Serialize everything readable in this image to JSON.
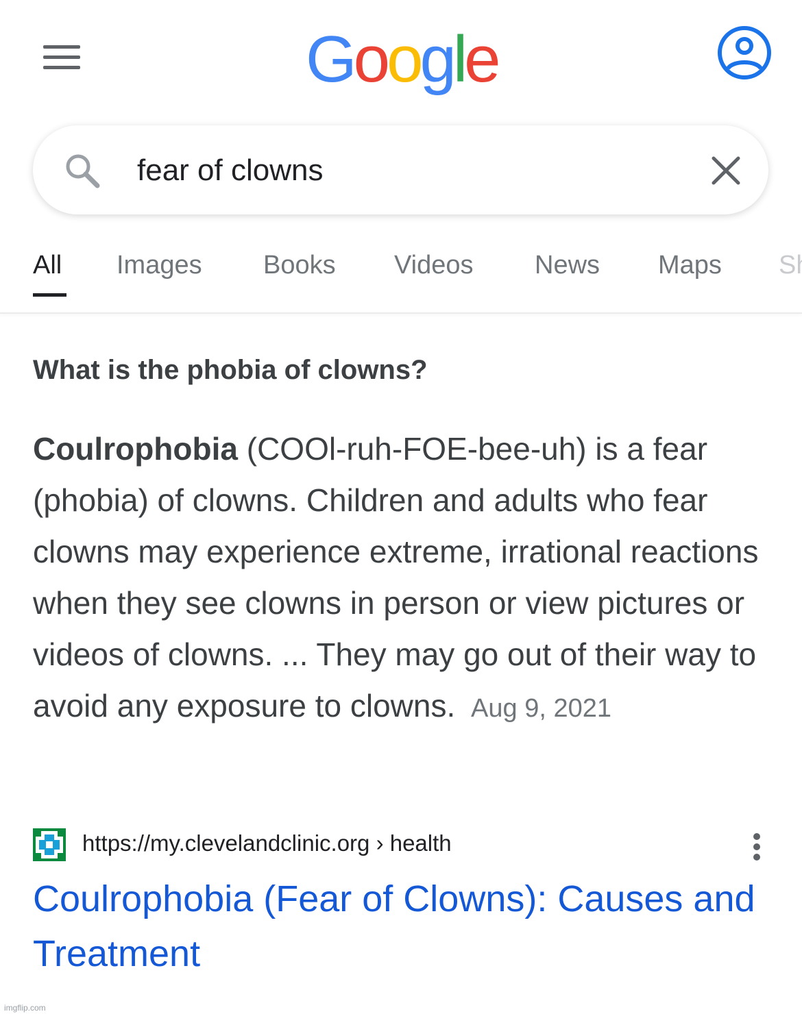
{
  "header": {
    "logo_letters": [
      {
        "char": "G",
        "color": "#4285f4"
      },
      {
        "char": "o",
        "color": "#ea4335"
      },
      {
        "char": "o",
        "color": "#fbbc05"
      },
      {
        "char": "g",
        "color": "#4285f4"
      },
      {
        "char": "l",
        "color": "#34a853"
      },
      {
        "char": "e",
        "color": "#ea4335"
      }
    ],
    "menu_icon": "hamburger-menu-icon",
    "account_icon": "account-circle-icon",
    "accent_color": "#1a73e8"
  },
  "search": {
    "query": "fear of clowns",
    "search_icon": "search-icon",
    "clear_icon": "close-icon"
  },
  "tabs": [
    {
      "label": "All",
      "active": true
    },
    {
      "label": "Images",
      "active": false
    },
    {
      "label": "Books",
      "active": false
    },
    {
      "label": "Videos",
      "active": false
    },
    {
      "label": "News",
      "active": false
    },
    {
      "label": "Maps",
      "active": false
    },
    {
      "label": "Sh",
      "active": false
    }
  ],
  "featured_snippet": {
    "question": "What is the phobia of clowns?",
    "term": "Coulrophobia",
    "body": " (COOl-ruh-FOE-bee-uh) is a fear (phobia) of clowns. Children and adults who fear clowns may experience extreme, irrational reactions when they see clowns in person or view pictures or videos of clowns. ... They may go out of their way to avoid any exposure to clowns.",
    "date": "Aug 9, 2021"
  },
  "result": {
    "url": "https://my.clevelandclinic.org › health",
    "title": "Coulrophobia (Fear of Clowns): Causes and Treatment",
    "favicon": "cleveland-clinic-favicon",
    "favicon_color": "#0b8a3f",
    "title_color": "#1558d6",
    "more_icon": "more-vert-icon"
  },
  "watermark": "imgflip.com"
}
